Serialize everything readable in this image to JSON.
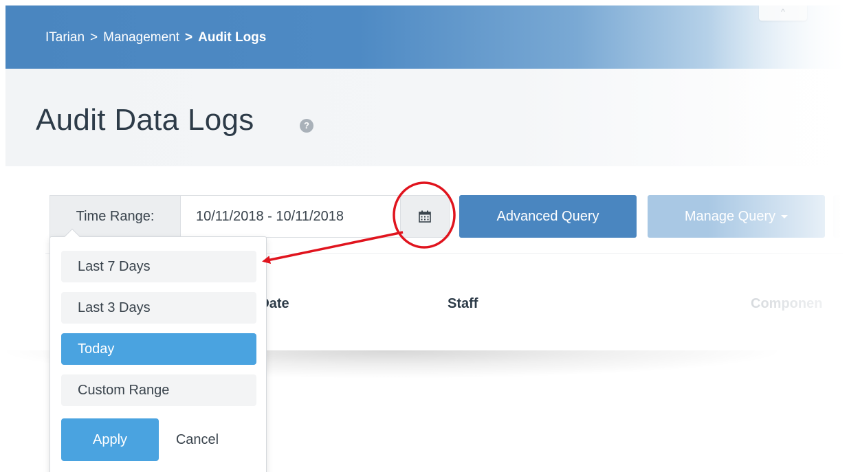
{
  "breadcrumb": {
    "items": [
      "ITarian",
      "Management",
      "Audit Logs"
    ],
    "separator": ">"
  },
  "collapse_glyph": "^",
  "page": {
    "title": "Audit Data Logs",
    "help_glyph": "?"
  },
  "toolbar": {
    "time_range_label": "Time Range:",
    "date_range_value": "10/11/2018 - 10/11/2018",
    "calendar_icon": "calendar-icon",
    "advanced_query_label": "Advanced Query",
    "manage_query_label": "Manage Query"
  },
  "table": {
    "columns": [
      "ation Date",
      "Staff",
      "Componen"
    ]
  },
  "dropdown": {
    "options": [
      "Last 7 Days",
      "Last 3 Days",
      "Today",
      "Custom Range"
    ],
    "selected": "Today",
    "apply_label": "Apply",
    "cancel_label": "Cancel"
  },
  "colors": {
    "header_blue": "#4a86c0",
    "accent_blue": "#4aa3e0",
    "annotation_red": "#e0141e"
  }
}
